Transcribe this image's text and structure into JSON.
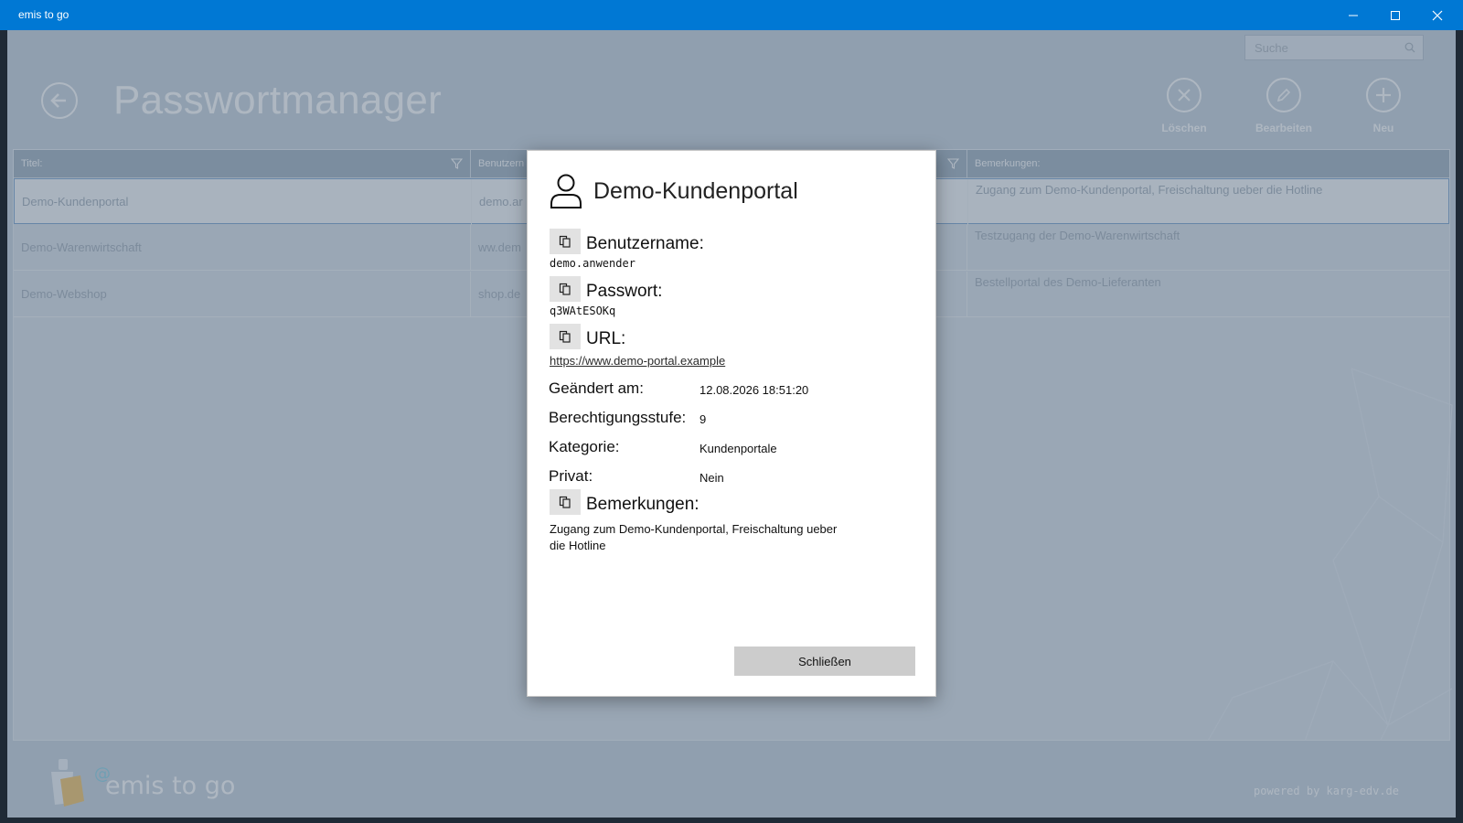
{
  "window": {
    "app_title": "emis to go",
    "controls": [
      "minimize-icon",
      "maximize-icon",
      "close-icon"
    ]
  },
  "header": {
    "page_title": "Passwortmanager",
    "search_placeholder": "Suche",
    "actions": [
      {
        "label": "Löschen",
        "icon": "x-circle-icon"
      },
      {
        "label": "Bearbeiten",
        "icon": "pencil-circle-icon"
      },
      {
        "label": "Neu",
        "icon": "plus-circle-icon"
      }
    ]
  },
  "grid": {
    "columns": {
      "title": "Titel:",
      "username": "Benutzern",
      "notes": "Bemerkungen:"
    },
    "rows": [
      {
        "title": "Demo-Kundenportal",
        "username": "demo.ar",
        "notes": "Zugang zum Demo-Kundenportal, Freischaltung ueber die Hotline",
        "selected": true
      },
      {
        "title": "Demo-Warenwirtschaft",
        "username": "ww.dem",
        "notes": "Testzugang der Demo-Warenwirtschaft",
        "selected": false
      },
      {
        "title": "Demo-Webshop",
        "username": "shop.de",
        "notes": "Bestellportal des Demo-Lieferanten",
        "selected": false
      }
    ]
  },
  "footer": {
    "logo_at": "@",
    "logo_text": "emis to go",
    "powered_by": "powered by karg-edv.de"
  },
  "dialog": {
    "title": "Demo-Kundenportal",
    "username_label": "Benutzername:",
    "username_value": "demo.anwender",
    "password_label": "Passwort:",
    "password_value": "q3WAtESOKq",
    "url_label": "URL:",
    "url_value": "https://www.demo-portal.example",
    "changed_label": "Geändert am:",
    "changed_value": "12.08.2026 18:51:20",
    "level_label": "Berechtigungsstufe:",
    "level_value": "9",
    "category_label": "Kategorie:",
    "category_value": "Kundenportale",
    "private_label": "Privat:",
    "private_value": "Nein",
    "notes_label": "Bemerkungen:",
    "notes_value": "Zugang zum Demo-Kundenportal, Freischaltung ueber die Hotline",
    "close_label": "Schließen"
  },
  "colors": {
    "titlebar": "#0078d4",
    "app_background": "#c9d3de",
    "overlay": "#4b5f76",
    "dialog_background": "#ffffff"
  }
}
